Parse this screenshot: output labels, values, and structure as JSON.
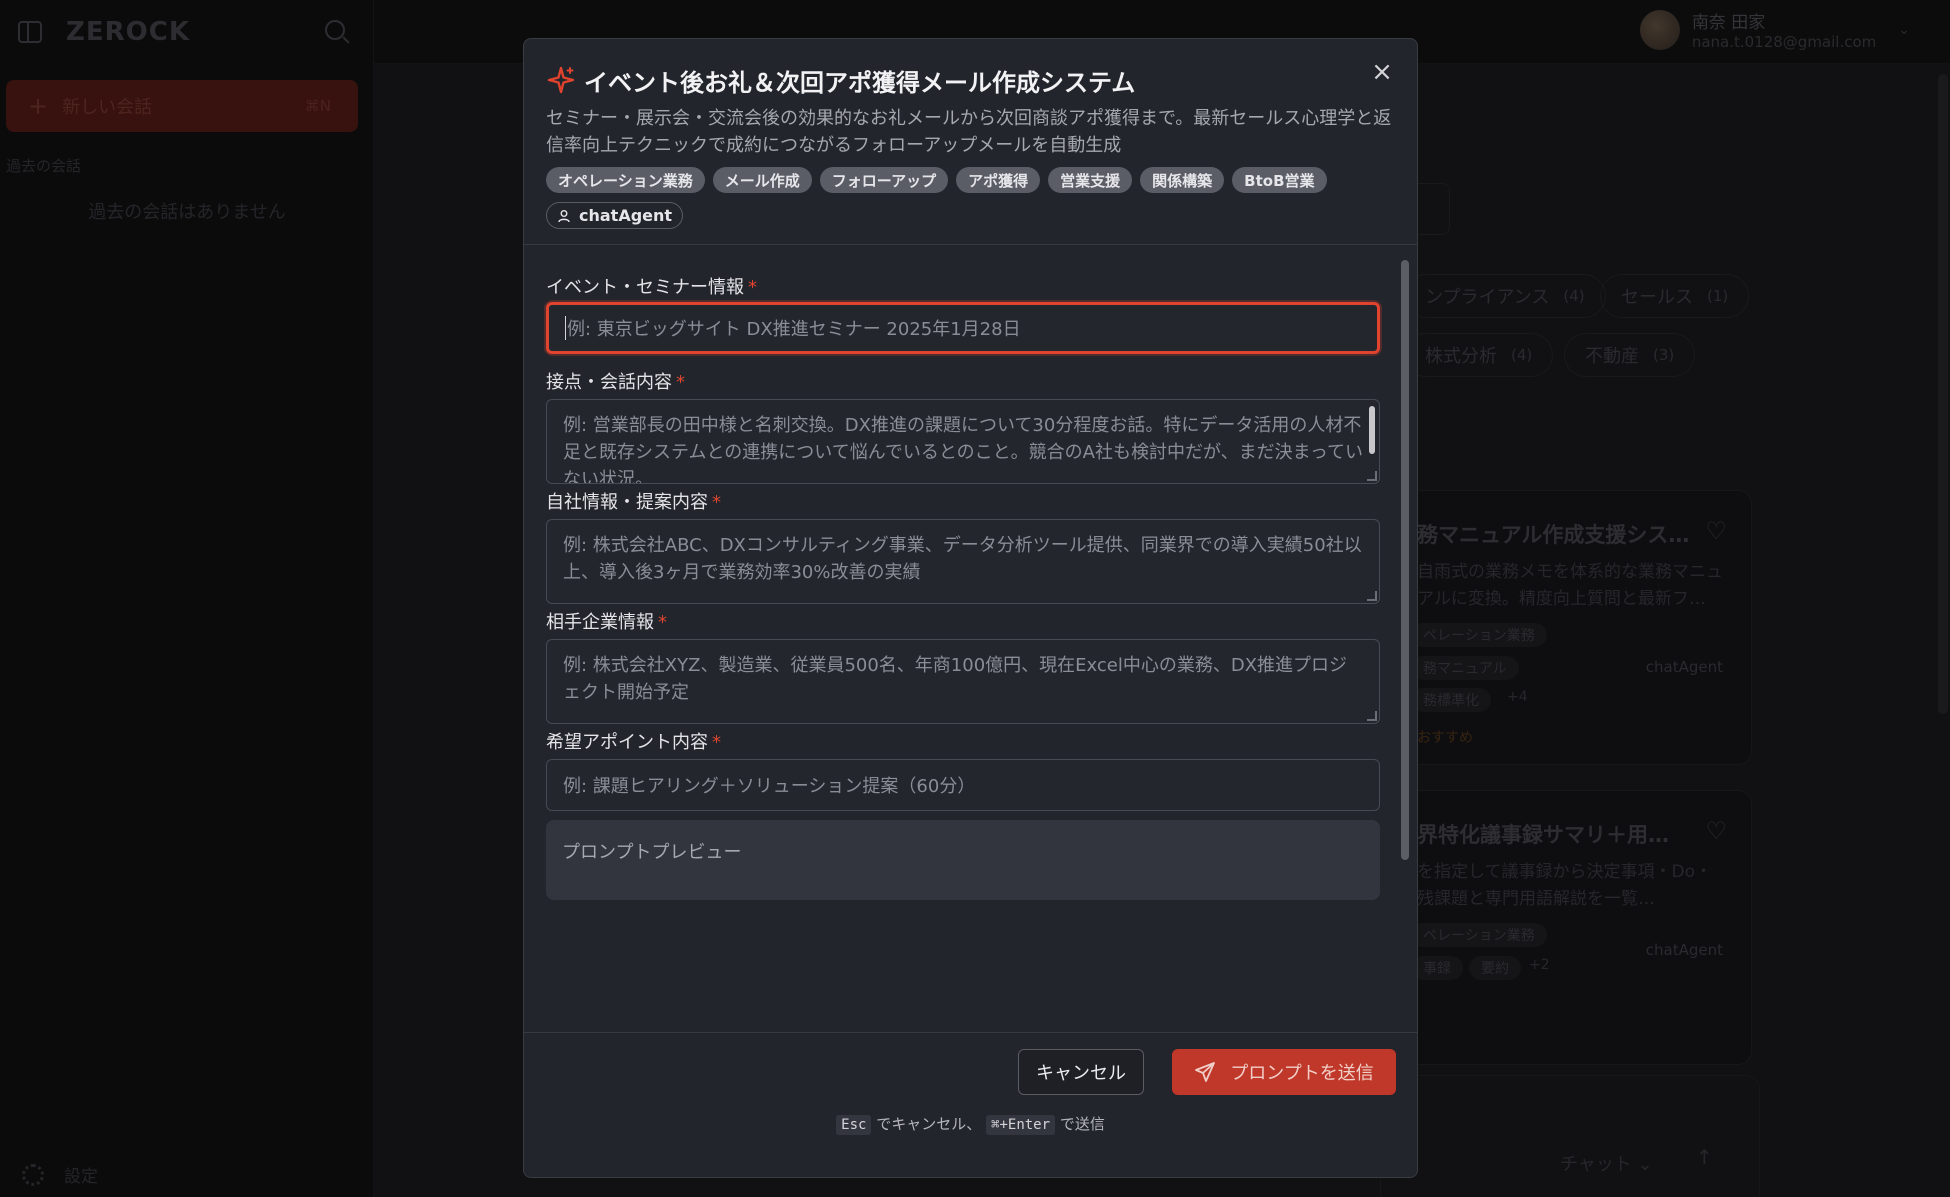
{
  "app": {
    "logo": "ZEROCK",
    "new_chat_label": "新しい会話",
    "new_chat_shortcut": "⌘N",
    "past_title": "過去の会話",
    "past_empty": "過去の会話はありません",
    "settings_label": "設定",
    "user_name": "南奈 田家",
    "user_email": "nana.t.0128@gmail.com",
    "accent_color": "#e0442e"
  },
  "background": {
    "chips": [
      {
        "label": "ンプライアンス",
        "count": "(4)"
      },
      {
        "label": "セールス",
        "count": "(1)"
      },
      {
        "label": "株式分析",
        "count": "(4)"
      },
      {
        "label": "不動産",
        "count": "(3)"
      }
    ],
    "cards": [
      {
        "title": "務マニュアル作成支援シス…",
        "desc": "自雨式の業務メモを体系的な業務マニュアルに変換。精度向上質問と最新フ…",
        "tags": [
          "ペレーション業務",
          "務マニュアル",
          "務標準化"
        ],
        "more": "+4",
        "agent": "chatAgent",
        "recommend": "おすすめ"
      },
      {
        "title": "界特化議事録サマリ＋用…",
        "desc": "を指定して議事録から決定事項・Do・残課題と専門用語解説を一覧…",
        "tags": [
          "ペレーション業務",
          "事録",
          "要約"
        ],
        "more": "+2",
        "agent": "chatAgent"
      }
    ],
    "bottom_chat": "チャット"
  },
  "modal": {
    "title": "イベント後お礼＆次回アポ獲得メール作成システム",
    "description": "セミナー・展示会・交流会後の効果的なお礼メールから次回商談アポ獲得まで。最新セールス心理学と返信率向上テクニックで成約につながるフォローアップメールを自動生成",
    "tags": [
      "オペレーション業務",
      "メール作成",
      "フォローアップ",
      "アポ獲得",
      "営業支援",
      "関係構築",
      "BtoB営業"
    ],
    "agent": "chatAgent",
    "fields": [
      {
        "label": "イベント・セミナー情報",
        "required": "*",
        "placeholder": "例: 東京ビッグサイト DX推進セミナー 2025年1月28日"
      },
      {
        "label": "接点・会話内容",
        "required": "*",
        "placeholder": "例: 営業部長の田中様と名刺交換。DX推進の課題について30分程度お話。特にデータ活用の人材不足と既存システムとの連携について悩んでいるとのこと。競合のA社も検討中だが、まだ決まっていない状況。"
      },
      {
        "label": "自社情報・提案内容",
        "required": "*",
        "placeholder": "例: 株式会社ABC、DXコンサルティング事業、データ分析ツール提供、同業界での導入実績50社以上、導入後3ヶ月で業務効率30%改善の実績"
      },
      {
        "label": "相手企業情報",
        "required": "*",
        "placeholder": "例: 株式会社XYZ、製造業、従業員500名、年商100億円、現在Excel中心の業務、DX推進プロジェクト開始予定"
      },
      {
        "label": "希望アポイント内容",
        "required": "*",
        "placeholder": "例: 課題ヒアリング＋ソリューション提案（60分）"
      }
    ],
    "preview_label": "プロンプトプレビュー",
    "cancel_label": "キャンセル",
    "send_label": "プロンプトを送信",
    "hint": {
      "esc_key": "Esc",
      "esc_text": "でキャンセル、",
      "enter_key": "⌘+Enter",
      "enter_text": "で送信"
    }
  }
}
